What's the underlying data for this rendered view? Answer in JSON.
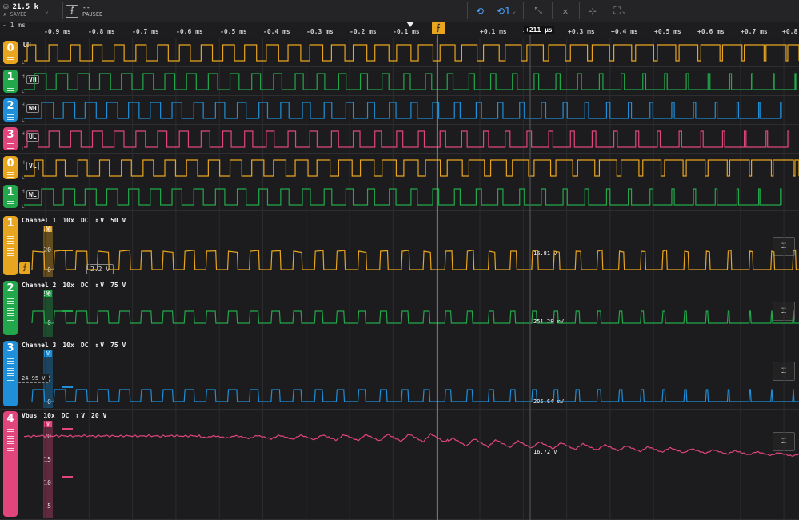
{
  "toolbar": {
    "sample_rate": "21.5 k",
    "save_status": "SAVED",
    "trigger_value": "--",
    "run_status": "PAUSED"
  },
  "ruler": {
    "left_label": "- 1 ms",
    "ticks": [
      "-0.9 ms",
      "-0.8 ms",
      "-0.7 ms",
      "-0.6 ms",
      "-0.5 ms",
      "-0.4 ms",
      "-0.3 ms",
      "-0.2 ms",
      "-0.1 ms",
      "+0.1 ms",
      "+0.2 ms",
      "+0.3 ms",
      "+0.4 ms",
      "+0.5 ms",
      "+0.6 ms",
      "+0.7 ms",
      "+0.8"
    ],
    "cursor_label": "+211 µs"
  },
  "digital_channels": [
    {
      "badge": "0",
      "name": "UH",
      "color": "#e8a520",
      "h": "H",
      "l": "L"
    },
    {
      "badge": "1",
      "name": "VH",
      "color": "#22a84a",
      "h": "H",
      "l": "L"
    },
    {
      "badge": "2",
      "name": "WH",
      "color": "#1e8fd8",
      "h": "H",
      "l": "L"
    },
    {
      "badge": "3",
      "name": "UL",
      "color": "#e0457b",
      "h": "H",
      "l": "L"
    },
    {
      "badge": "0",
      "name": "VL",
      "color": "#e8a520",
      "h": "H",
      "l": "L"
    },
    {
      "badge": "1",
      "name": "WL",
      "color": "#22a84a",
      "h": "H",
      "l": "L"
    }
  ],
  "analog_channels": [
    {
      "badge": "1",
      "name": "Channel 1",
      "probe": "10x",
      "coupling": "DC",
      "unit_icon": "↕",
      "unit": "V",
      "scale": "50 V",
      "color": "#e8a520",
      "vtag": "V",
      "yticks": [
        "40",
        "20",
        "0"
      ],
      "readout": "16.81 V",
      "trigger_level": "2.2 V"
    },
    {
      "badge": "2",
      "name": "Channel 2",
      "probe": "10x",
      "coupling": "DC",
      "unit_icon": "↕",
      "unit": "V",
      "scale": "75 V",
      "color": "#22a84a",
      "vtag": "V",
      "yticks": [
        "50",
        "0"
      ],
      "readout": "251.28 mV"
    },
    {
      "badge": "3",
      "name": "Channel 3",
      "probe": "10x",
      "coupling": "DC",
      "unit_icon": "↕",
      "unit": "V",
      "scale": "75 V",
      "color": "#1e8fd8",
      "vtag": "V",
      "yticks": [
        "0"
      ],
      "readout": "295.64 mV",
      "level_box": "24.95 V"
    },
    {
      "badge": "4",
      "name": "Vbus",
      "probe": "10x",
      "coupling": "DC",
      "unit_icon": "↕",
      "unit": "V",
      "scale": "20 V",
      "color": "#e0457b",
      "vtag": "V",
      "yticks": [
        "20",
        "15",
        "10",
        "5"
      ],
      "readout": "16.72 V"
    }
  ],
  "icons": {
    "save": "disk-icon",
    "trigger": "trigger-rising-edge-icon",
    "loop": "loop-icon",
    "single": "single-capture-icon",
    "fit": "fit-vertical-icon"
  }
}
